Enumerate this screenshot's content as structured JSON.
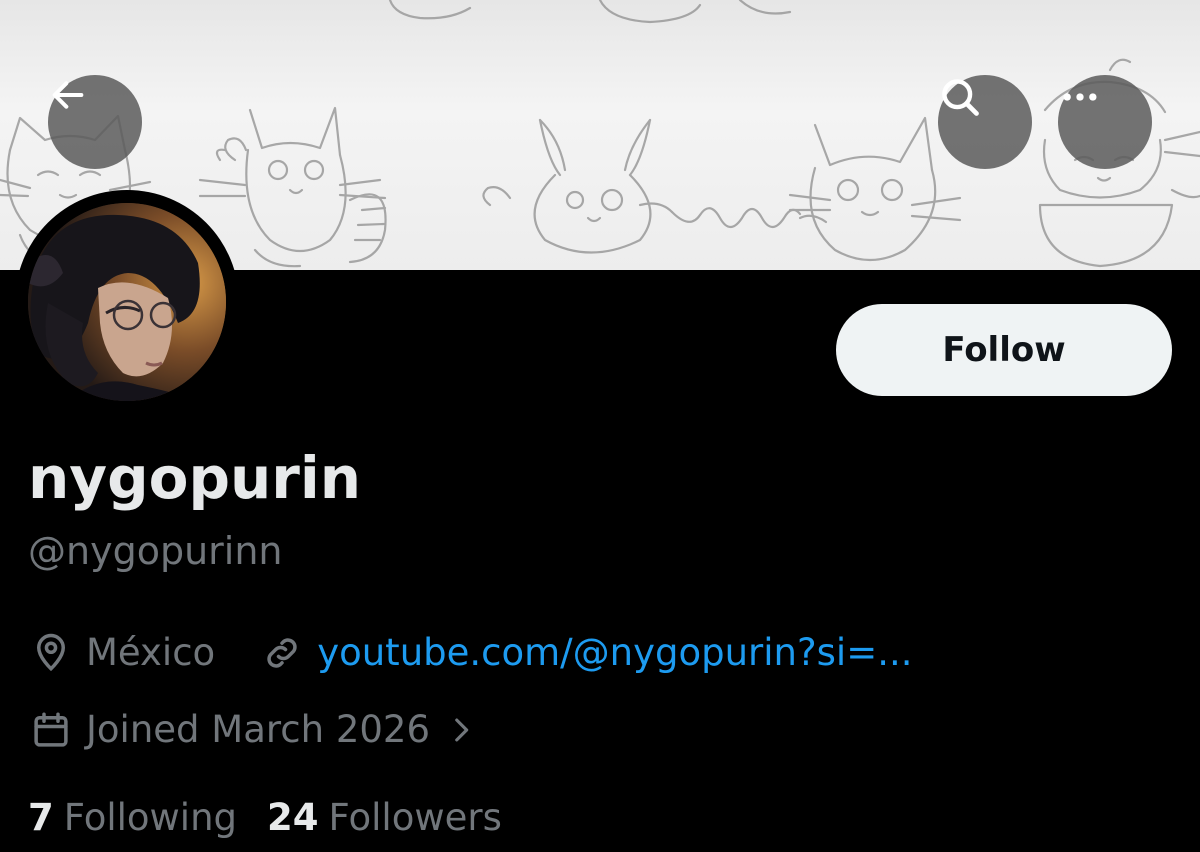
{
  "profile": {
    "display_name": "nygopurin",
    "handle": "@nygopurinn",
    "location": "México",
    "website": "youtube.com/@nygopurin?si=...",
    "joined": "Joined March 2026",
    "following_count": "7",
    "following_label": "Following",
    "followers_count": "24",
    "followers_label": "Followers"
  },
  "actions": {
    "follow_label": "Follow"
  },
  "icons": {
    "back": "arrow-left-icon",
    "search": "search-icon",
    "more": "more-horizontal-icon",
    "location": "location-pin-icon",
    "link": "link-icon",
    "calendar": "calendar-icon",
    "chevron": "chevron-right-icon"
  },
  "colors": {
    "background": "#000000",
    "primary_text": "#e7e9ea",
    "secondary_text": "#71767b",
    "link": "#1d9bf0",
    "follow_button_bg": "#eff3f4"
  }
}
